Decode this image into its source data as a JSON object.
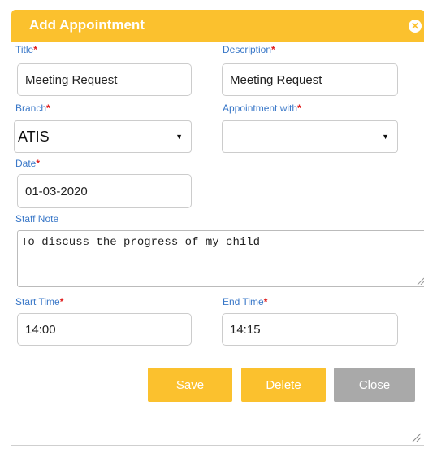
{
  "dialog": {
    "title": "Add Appointment",
    "close_icon": "close-icon"
  },
  "labels": {
    "title": "Title",
    "description": "Description",
    "branch": "Branch",
    "appointment_with": "Appointment with",
    "date": "Date",
    "staff_note": "Staff Note",
    "start_time": "Start Time",
    "end_time": "End Time",
    "required_marker": "*"
  },
  "fields": {
    "title_value": "Meeting Request",
    "description_value": "Meeting Request",
    "branch_value": "ATIS",
    "appointment_with_value": "",
    "date_value": "01-03-2020",
    "staff_note_value": "To discuss the progress of my child",
    "start_time_value": "14:00",
    "end_time_value": "14:15"
  },
  "buttons": {
    "save": "Save",
    "delete": "Delete",
    "close": "Close"
  },
  "colors": {
    "accent": "#fbc12e",
    "label_blue": "#3a78c8",
    "required_red": "#e02020",
    "close_grey": "#a9a9a9"
  }
}
